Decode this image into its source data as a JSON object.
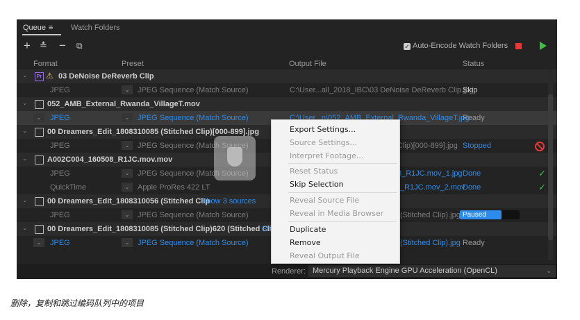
{
  "tabs": [
    {
      "label": "Queue"
    },
    {
      "label": "Watch Folders"
    }
  ],
  "toolbar": {
    "auto_encode_label": "Auto-Encode Watch Folders"
  },
  "columns": {
    "format": "Format",
    "preset": "Preset",
    "output": "Output File",
    "status": "Status"
  },
  "groups": [
    {
      "title": "03 DeNoise DeReverb Clip",
      "badge": "Pr",
      "rows": [
        {
          "format": "JPEG",
          "preset": "JPEG Sequence (Match Source)",
          "output": "C:\\User...all_2018_IBC\\03 DeNoise DeReverb Clip.jpg",
          "status": "Skip"
        }
      ]
    },
    {
      "title": "052_AMB_External_Rwanda_VillageT.mov",
      "rows": [
        {
          "format": "JPEG",
          "preset": "JPEG Sequence (Match Source)",
          "output": "C:\\User...n\\052_AMB_External_Rwanda_VillageT.jpg",
          "status": "Ready"
        }
      ]
    },
    {
      "title": "00 Dreamers_Edit_1808310085 (Stitched Clip)[000-899].jpg",
      "rows": [
        {
          "format": "JPEG",
          "preset": "JPEG Sequence (Match Source)",
          "output": "Clip)[000-899].jpg",
          "status": "Stopped"
        }
      ]
    },
    {
      "title": "A002C004_160508_R1JC.mov.mov",
      "rows": [
        {
          "format": "JPEG",
          "preset": "JPEG Sequence (Match Source)",
          "output": "8_R1JC.mov_1.jpg",
          "status": "Done"
        },
        {
          "format": "QuickTime",
          "preset": "Apple ProRes 422 LT",
          "output": "_R1JC.mov_2.mov",
          "status": "Done"
        }
      ]
    },
    {
      "title": "00 Dreamers_Edit_1808310056 (Stitched Clip",
      "link": "Show 3 sources",
      "rows": [
        {
          "format": "JPEG",
          "preset": "JPEG Sequence (Match Source)",
          "output": "(Stitched Clip).jpg",
          "status": "Paused",
          "progress": 0.65
        }
      ]
    },
    {
      "title": "00 Dreamers_Edit_1808310085 (Stitched Clip)620 (Stitched Clip",
      "link": "Sh",
      "rows": [
        {
          "format": "JPEG",
          "preset": "JPEG Sequence (Match Source)",
          "output": "(Stitched Clip).jpg",
          "status": "Ready"
        }
      ]
    }
  ],
  "context_menu": {
    "items": [
      {
        "label": "Export Settings...",
        "enabled": true
      },
      {
        "label": "Source Settings...",
        "enabled": false
      },
      {
        "label": "Interpret Footage...",
        "enabled": false
      },
      {
        "label": "Reset Status",
        "enabled": false
      },
      {
        "label": "Skip Selection",
        "enabled": true
      },
      {
        "label": "Reveal Source File",
        "enabled": false
      },
      {
        "label": "Reveal in Media Browser",
        "enabled": false
      },
      {
        "label": "Duplicate",
        "enabled": true
      },
      {
        "label": "Remove",
        "enabled": true
      },
      {
        "label": "Reveal Output File",
        "enabled": false
      }
    ]
  },
  "renderer": {
    "label": "Renderer:",
    "value": "Mercury Playback Engine GPU Acceleration (OpenCL)"
  },
  "caption": "删除，复制和跳过编码队列中的项目",
  "colors": {
    "accent": "#2d8ceb",
    "stop": "#e03a3a",
    "play": "#3fbf3f",
    "warning": "#e6c23a"
  }
}
